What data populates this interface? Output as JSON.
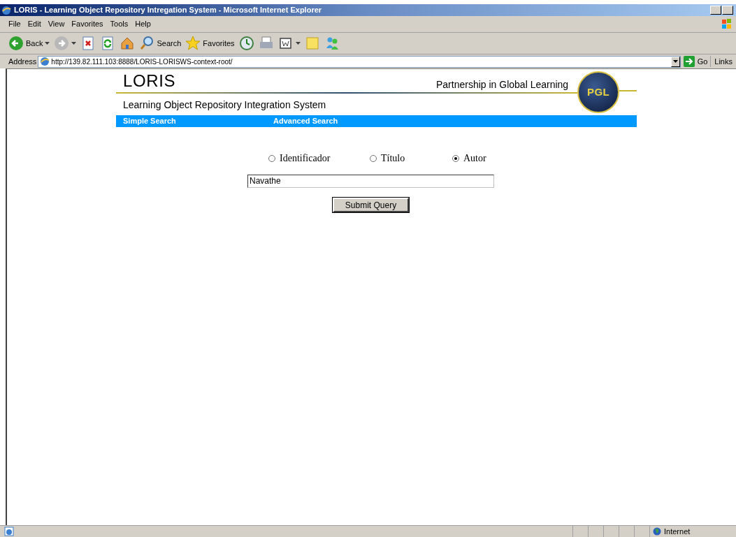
{
  "window": {
    "title": "LORIS - Learning Object Repository Intregation System - Microsoft Internet Explorer"
  },
  "menu": [
    "File",
    "Edit",
    "View",
    "Favorites",
    "Tools",
    "Help"
  ],
  "toolbar": [
    {
      "kind": "back",
      "label": "Back"
    },
    {
      "kind": "forward"
    },
    {
      "kind": "stop"
    },
    {
      "kind": "refresh"
    },
    {
      "kind": "home"
    },
    {
      "kind": "search",
      "label": "Search"
    },
    {
      "kind": "favorites",
      "label": "Favorites"
    },
    {
      "kind": "history"
    },
    {
      "kind": "print"
    },
    {
      "kind": "word"
    },
    {
      "kind": "note"
    },
    {
      "kind": "messenger"
    }
  ],
  "address_bar": {
    "label": "Address",
    "url": "http://139.82.111.103:8888/LORIS-LORISWS-context-root/",
    "go": "Go",
    "links": "Links"
  },
  "page": {
    "brand": "LORIS",
    "tagline": "Partnership in Global Learning",
    "logo_text": "PGL",
    "subtitle": "Learning Object Repository Integration System",
    "nav": [
      "Simple Search",
      "Advanced Search"
    ],
    "options": [
      {
        "label": "Identificador",
        "selected": false
      },
      {
        "label": "Título",
        "selected": false
      },
      {
        "label": "Autor",
        "selected": true
      }
    ],
    "query": "Navathe",
    "submit": "Submit Query"
  },
  "status_bar": {
    "zone": "Internet"
  }
}
